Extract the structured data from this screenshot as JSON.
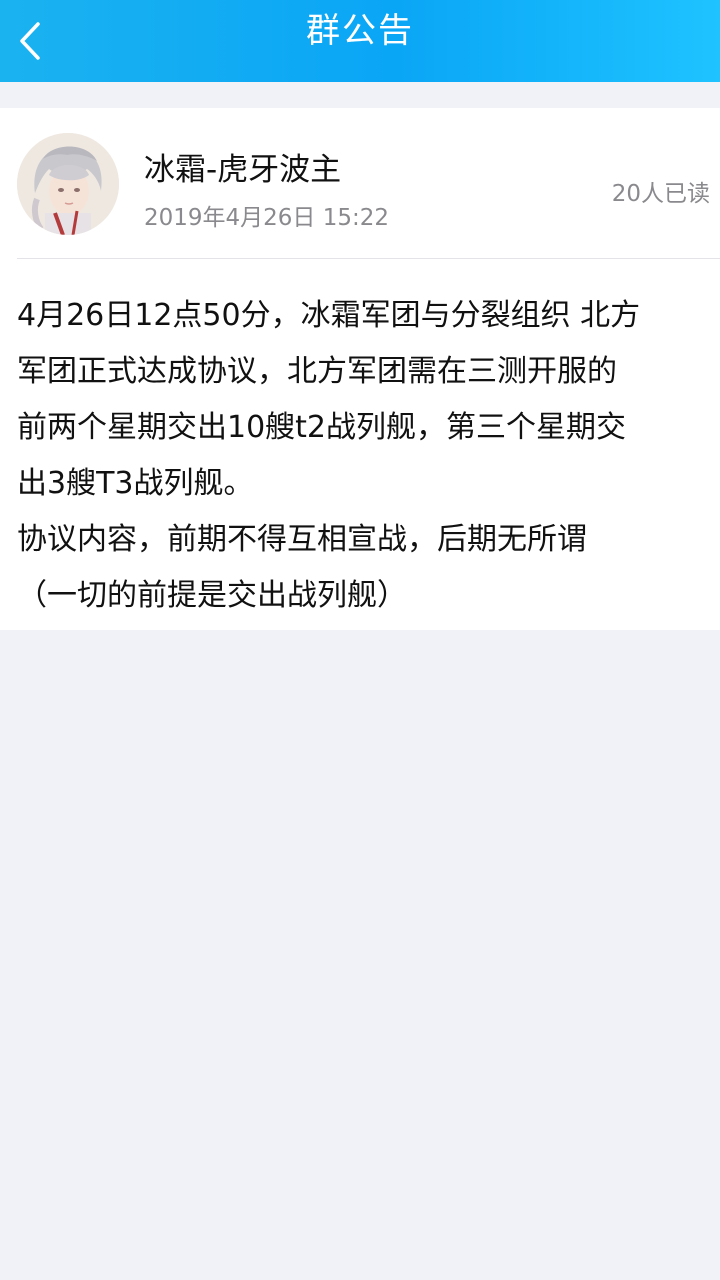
{
  "header": {
    "title": "群公告",
    "back_icon": "chevron-left-icon",
    "gradient_colors": [
      "#1bb2f0",
      "#0aa6f6",
      "#1ec3ff"
    ]
  },
  "announcement": {
    "author": "冰霜-虎牙波主",
    "timestamp": "2019年4月26日 15:22",
    "read_count": "20人已读",
    "avatar": "anime-character-avatar",
    "body_lines": [
      "4月26日12点50分，冰霜军团与分裂组织 北方",
      "军团正式达成协议，北方军团需在三测开服的",
      "前两个星期交出10艘t2战列舰，第三个星期交",
      "出3艘T3战列舰。",
      "协议内容，前期不得互相宣战，后期无所谓",
      "（一切的前提是交出战列舰）"
    ]
  },
  "colors": {
    "page_background": "#f1f2f7",
    "card_background": "#ffffff",
    "secondary_text": "#8a8a8e"
  }
}
